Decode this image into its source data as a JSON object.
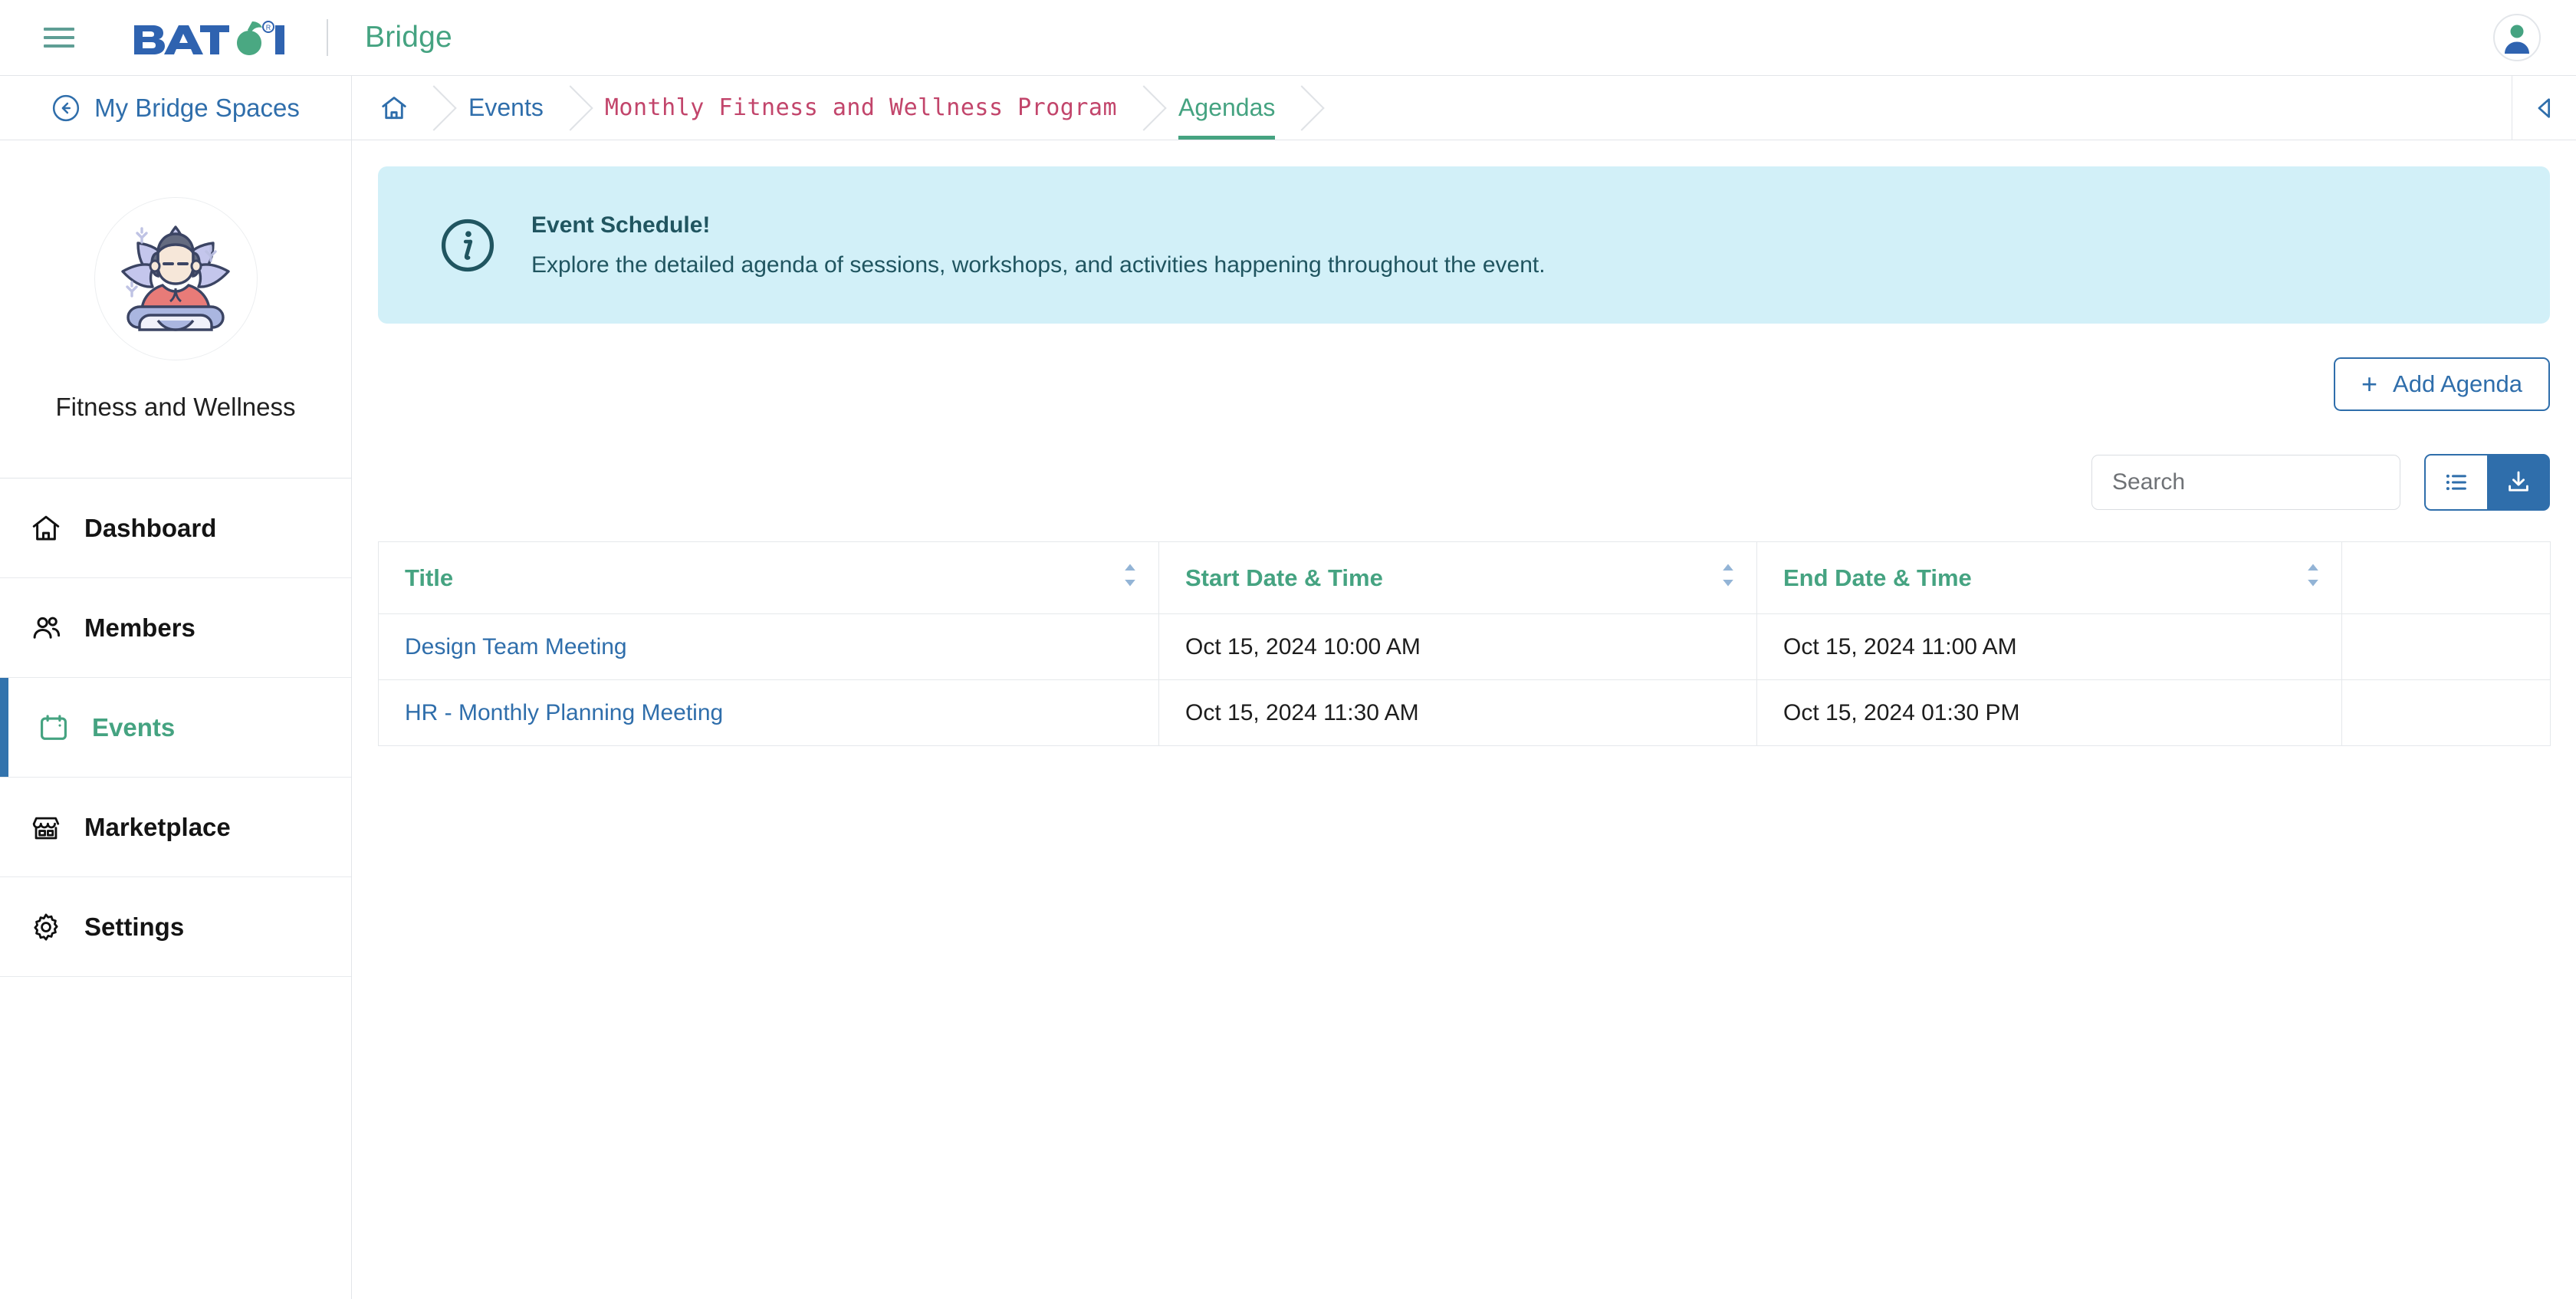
{
  "topbar": {
    "menu_icon": "hamburger-icon",
    "brand": "BATOI",
    "product": "Bridge",
    "avatar_icon": "user-avatar-icon"
  },
  "sidebar": {
    "back_label": "My Bridge Spaces",
    "back_icon": "arrow-left-circle-icon",
    "space_name": "Fitness and Wellness",
    "space_avatar_icon": "yoga-lotus-avatar",
    "items": [
      {
        "label": "Dashboard",
        "icon": "home-icon",
        "active": false
      },
      {
        "label": "Members",
        "icon": "users-icon",
        "active": false
      },
      {
        "label": "Events",
        "icon": "calendar-icon",
        "active": true
      },
      {
        "label": "Marketplace",
        "icon": "storefront-icon",
        "active": false
      },
      {
        "label": "Settings",
        "icon": "gear-icon",
        "active": false
      }
    ]
  },
  "breadcrumb": {
    "home_icon": "home-icon",
    "items": [
      {
        "label": "Events"
      },
      {
        "label": "Monthly Fitness and Wellness Program"
      },
      {
        "label": "Agendas"
      }
    ],
    "collapse_icon": "triangle-left-icon"
  },
  "alert": {
    "icon": "info-circle-icon",
    "title": "Event Schedule!",
    "message": "Explore the detailed agenda of sessions, workshops, and activities happening throughout the event."
  },
  "toolbar": {
    "add_label": "Add Agenda",
    "add_icon": "plus-icon",
    "search_placeholder": "Search",
    "search_value": "",
    "list_view_icon": "list-icon",
    "download_icon": "download-icon"
  },
  "table": {
    "columns": [
      {
        "label": "Title",
        "sort_icon": "sort-updown-icon"
      },
      {
        "label": "Start Date & Time",
        "sort_icon": "sort-updown-icon"
      },
      {
        "label": "End Date & Time",
        "sort_icon": "sort-updown-icon"
      },
      {
        "label": ""
      }
    ],
    "rows": [
      {
        "title": "Design Team Meeting",
        "start": "Oct 15, 2024 10:00 AM",
        "end": "Oct 15, 2024 11:00 AM",
        "actions": ""
      },
      {
        "title": "HR - Monthly Planning Meeting",
        "start": "Oct 15, 2024 11:30 AM",
        "end": "Oct 15, 2024 01:30 PM",
        "actions": ""
      }
    ]
  },
  "colors": {
    "brand_blue": "#2f6eab",
    "brand_green": "#45a381",
    "crumb_pink": "#c2456b",
    "alert_bg": "#d2f0f8",
    "alert_fg": "#205560"
  }
}
